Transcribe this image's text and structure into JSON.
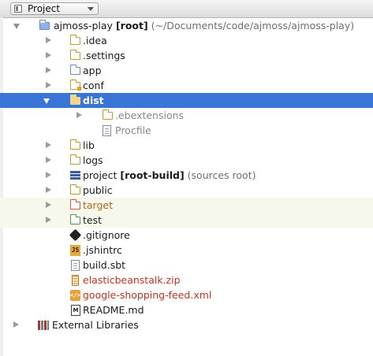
{
  "toolbar": {
    "view_label": "Project"
  },
  "tree": {
    "root": {
      "name": "ajmoss-play",
      "tag": "[root]",
      "path": "(~/Documents/code/ajmoss/ajmoss-play)"
    },
    "items": [
      {
        "label": ".idea"
      },
      {
        "label": ".settings"
      },
      {
        "label": "app"
      },
      {
        "label": "conf"
      },
      {
        "label": "dist"
      },
      {
        "label": ".ebextensions"
      },
      {
        "label": "Procfile"
      },
      {
        "label": "lib"
      },
      {
        "label": "logs"
      },
      {
        "label": "project",
        "tag": "[root-build]",
        "note": "(sources root)"
      },
      {
        "label": "public"
      },
      {
        "label": "target"
      },
      {
        "label": "test"
      },
      {
        "label": ".gitignore"
      },
      {
        "label": ".jshintrc"
      },
      {
        "label": "build.sbt"
      },
      {
        "label": "elasticbeanstalk.zip"
      },
      {
        "label": "google-shopping-feed.xml"
      },
      {
        "label": "README.md"
      },
      {
        "label": "External Libraries"
      }
    ],
    "icon_glyphs": {
      "js": "JS",
      "xml": "</>",
      "md": "M"
    }
  },
  "colors": {
    "selection": "#3875d7",
    "excluded_row": "#f7f8ec",
    "zip_text": "#c0341d",
    "xml_text": "#b8641a",
    "muted_text": "#888888"
  }
}
